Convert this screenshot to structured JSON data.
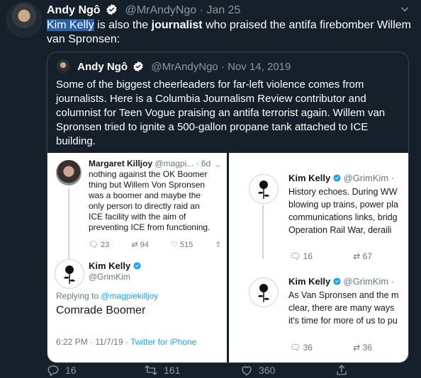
{
  "tweet": {
    "author_name": "Andy Ngô",
    "author_handle": "@MrAndyNgo",
    "date": "Jan 25",
    "text_highlight": "Kim Kelly",
    "text_before_bold": " is also the ",
    "text_bold": "journalist",
    "text_after_bold": " who praised the antifa firebomber Willem van Spronsen:",
    "replies": "16",
    "retweets": "161",
    "likes": "360"
  },
  "quoted": {
    "author_name": "Andy Ngô",
    "author_handle": "@MrAndyNgo",
    "date": "Nov 14, 2019",
    "text": "Some of the biggest cheerleaders for far-left violence comes from journalists. Here is a Columbia Journalism Review contributor and columnist for Teen Vogue praising an antifa terrorist again. Willem van Spronsen tried to ignite a 500-gallon propane tank attached to ICE building."
  },
  "screenshot_left": {
    "margaret_name": "Margaret Killjoy",
    "margaret_handle": "@magpi...",
    "margaret_time": "· 6d",
    "margaret_text": "nothing against the OK Boomer thing but Willem Von Spronsen was a boomer and maybe the only person to directly raid an ICE facility with the aim of preventing ICE from functioning.",
    "margaret_replies": "23",
    "margaret_retweets": "94",
    "margaret_likes": "515",
    "kim_name": "Kim Kelly",
    "kim_handle": "@GrimKim",
    "replying_label": "Replying to",
    "replying_handle": "@magpiekilljoy",
    "kim_text": "Comrade Boomer",
    "timestamp": "6:22 PM · 11/7/19 · ",
    "client": "Twitter for iPhone"
  },
  "screenshot_right": {
    "t1_name": "Kim Kelly",
    "t1_handle": "@GrimKim",
    "t1_lines": [
      "History echoes. During WW",
      "blowing up trains, power pla",
      "communications links, bridg",
      "Operation Rail War, deraili"
    ],
    "t1_replies": "16",
    "t1_retweets": "67",
    "t2_name": "Kim Kelly",
    "t2_handle": "@GrimKim",
    "t2_lines": [
      "As Van Spronsen and the m",
      "clear, there are many ways",
      "it's time for more of us to pu"
    ],
    "t2_replies": "36",
    "t2_retweets": "36"
  },
  "colors": {
    "background": "#15202b",
    "muted": "#8899a6",
    "link": "#1da1f2",
    "highlight": "#2b5fa8"
  }
}
